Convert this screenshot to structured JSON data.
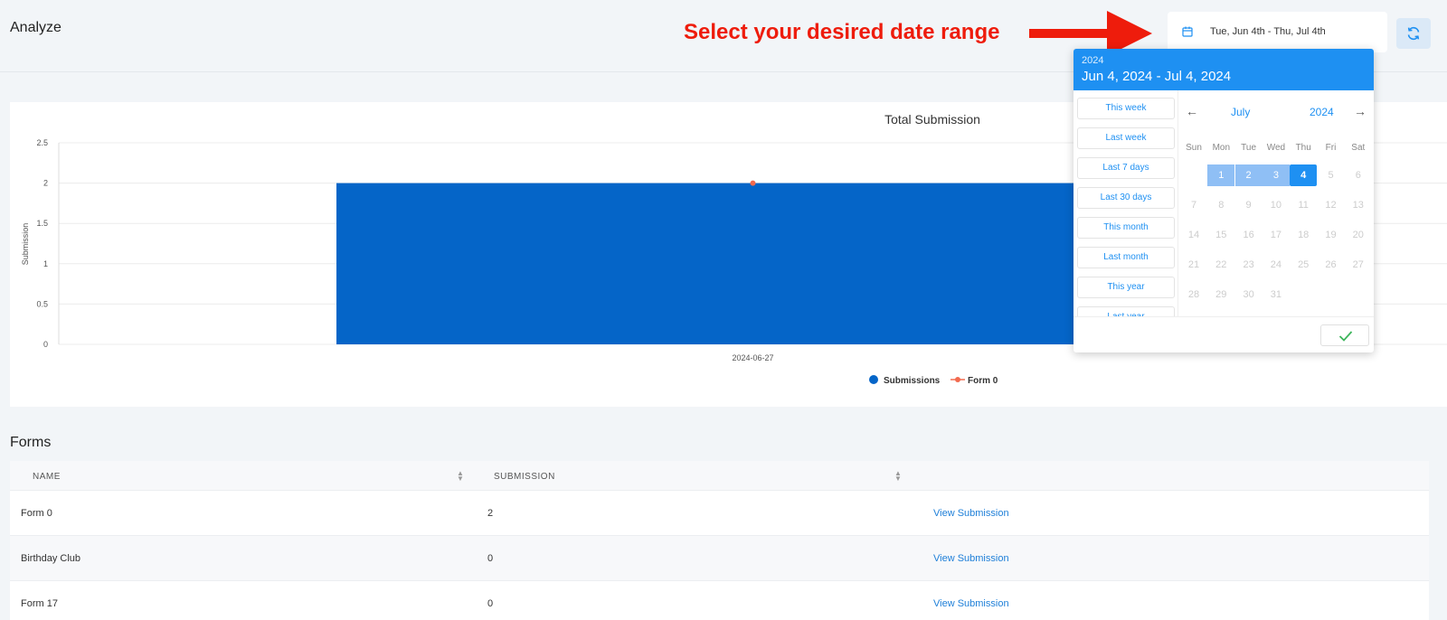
{
  "header": {
    "title": "Analyze",
    "annotation": "Select your desired date range",
    "date_range_label": "Tue, Jun 4th - Thu, Jul 4th"
  },
  "colors": {
    "accent": "#1e90f2",
    "bar": "#0565c8",
    "form_line": "#f26a4f",
    "annotation": "#ee1c0c"
  },
  "chart_data": {
    "type": "bar",
    "title": "Total Submission",
    "ylabel": "Submission",
    "xlabel": "",
    "ylim": [
      0,
      2.5
    ],
    "yticks": [
      "0",
      "0.5",
      "1",
      "1.5",
      "2",
      "2.5"
    ],
    "categories": [
      "2024-06-27"
    ],
    "series": [
      {
        "name": "Submissions",
        "kind": "bar",
        "values": [
          2
        ]
      },
      {
        "name": "Form 0",
        "kind": "line",
        "values": [
          2
        ]
      }
    ],
    "legend": "bottom-center",
    "grid": true
  },
  "datepicker": {
    "year": "2024",
    "range": "Jun 4, 2024 - Jul 4, 2024",
    "presets": [
      "This week",
      "Last week",
      "Last 7 days",
      "Last 30 days",
      "This month",
      "Last month",
      "This year",
      "Last year"
    ],
    "month": "July",
    "cal_year": "2024",
    "prev_icon": "arrow-left",
    "next_icon": "arrow-right",
    "weekdays": [
      "Sun",
      "Mon",
      "Tue",
      "Wed",
      "Thu",
      "Fri",
      "Sat"
    ],
    "first_weekday": 1,
    "days_in_month": 31,
    "in_range": [
      1,
      2,
      3
    ],
    "selected": 4,
    "confirm_icon": "check-icon"
  },
  "forms": {
    "title": "Forms",
    "columns": [
      "NAME",
      "SUBMISSION"
    ],
    "rows": [
      {
        "name": "Form 0",
        "submission": "2",
        "action": "View Submission"
      },
      {
        "name": "Birthday Club",
        "submission": "0",
        "action": "View Submission"
      },
      {
        "name": "Form 17",
        "submission": "0",
        "action": "View Submission"
      }
    ]
  }
}
